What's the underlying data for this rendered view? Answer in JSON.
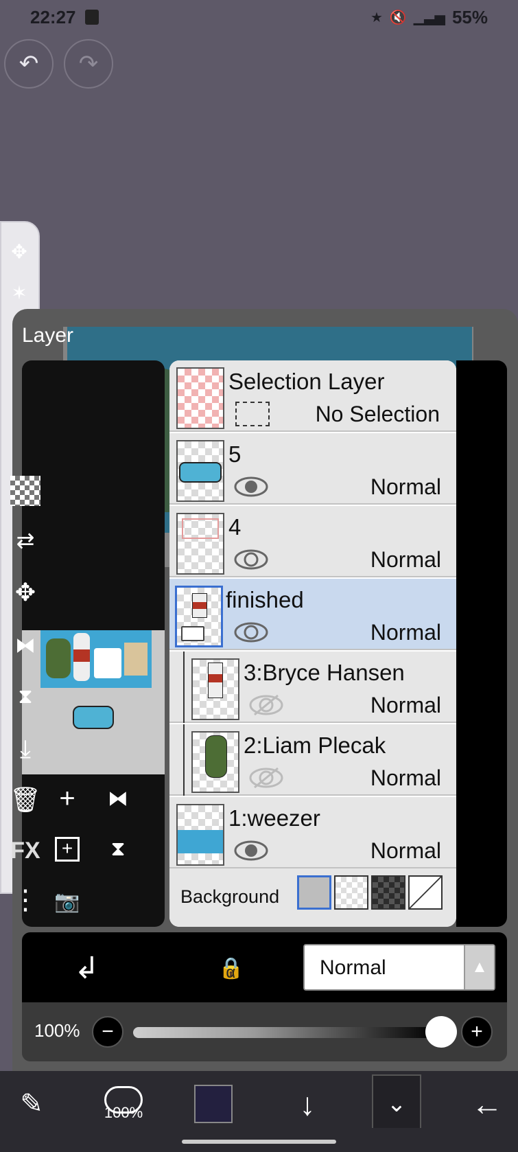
{
  "status": {
    "time": "22:27",
    "battery": "55%"
  },
  "panel": {
    "title": "Layer"
  },
  "layers": {
    "selection": {
      "name": "Selection Layer",
      "status": "No Selection"
    },
    "items": [
      {
        "name": "5",
        "blend": "Normal"
      },
      {
        "name": "4",
        "blend": "Normal"
      },
      {
        "name": "finished",
        "blend": "Normal"
      },
      {
        "name": "3:Bryce Hansen",
        "blend": "Normal"
      },
      {
        "name": "2:Liam Plecak",
        "blend": "Normal"
      },
      {
        "name": "1:weezer",
        "blend": "Normal"
      }
    ],
    "background_label": "Background"
  },
  "right_panel": {
    "fx_label": "FX"
  },
  "blend_bar": {
    "mode": "Normal",
    "lock_symbol": "α"
  },
  "opacity": {
    "label": "100%",
    "value": 1.0
  },
  "toolbar": {
    "brush_size": "100%"
  },
  "colors": {
    "current": "#23203f",
    "selected_row": "#c9d9ee"
  }
}
